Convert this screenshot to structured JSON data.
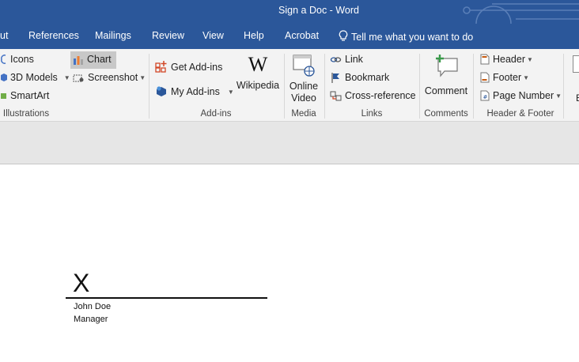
{
  "window": {
    "title": "Sign a Doc  -  Word"
  },
  "tabs": [
    {
      "label": "ut"
    },
    {
      "label": "References"
    },
    {
      "label": "Mailings"
    },
    {
      "label": "Review"
    },
    {
      "label": "View"
    },
    {
      "label": "Help"
    },
    {
      "label": "Acrobat"
    }
  ],
  "tell_me": {
    "label": "Tell me what you want to do"
  },
  "ribbon": {
    "illustrations": {
      "icons": "Icons",
      "models3d": "3D Models",
      "smartart": "SmartArt",
      "chart": "Chart",
      "screenshot": "Screenshot",
      "group_label": "Illustrations"
    },
    "addins": {
      "get": "Get Add-ins",
      "my": "My Add-ins",
      "wikipedia": "Wikipedia",
      "group_label": "Add-ins"
    },
    "media": {
      "online_video_1": "Online",
      "online_video_2": "Video",
      "group_label": "Media"
    },
    "links": {
      "link": "Link",
      "bookmark": "Bookmark",
      "cross_reference": "Cross-reference",
      "group_label": "Links"
    },
    "comments": {
      "comment": "Comment",
      "group_label": "Comments"
    },
    "header_footer": {
      "header": "Header",
      "footer": "Footer",
      "page_number": "Page Number",
      "group_label": "Header & Footer"
    },
    "edge_letter": "E"
  },
  "document": {
    "signature_mark": "X",
    "signer_name": "John Doe",
    "signer_title": "Manager"
  },
  "colors": {
    "accent": "#2b579a"
  }
}
